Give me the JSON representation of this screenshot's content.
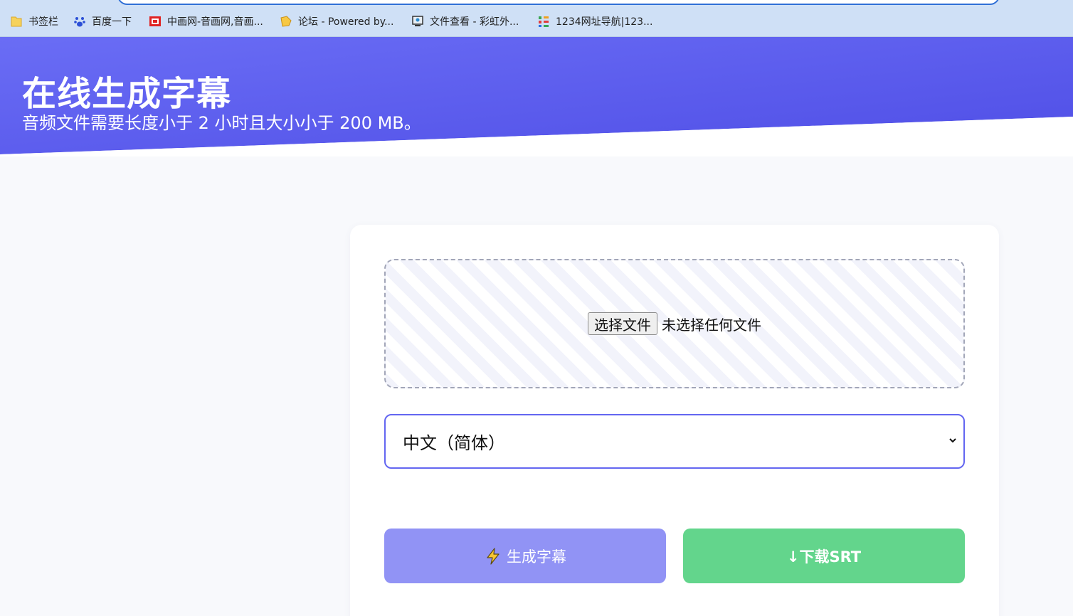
{
  "bookmarks": [
    {
      "label": "书签栏",
      "icon": "folder-icon"
    },
    {
      "label": "百度一下",
      "icon": "baidu-paw-icon"
    },
    {
      "label": "中画网-音画网,音画...",
      "icon": "red-site-icon"
    },
    {
      "label": "论坛 - Powered by...",
      "icon": "forum-icon"
    },
    {
      "label": "文件查看 - 彩虹外...",
      "icon": "file-view-icon"
    },
    {
      "label": "1234网址导航|123...",
      "icon": "nav-icon"
    }
  ],
  "header": {
    "title": "在线生成字幕",
    "subtitle": "音频文件需要长度小于 2 小时且大小小于 200 MB。"
  },
  "upload": {
    "button_label": "选择文件",
    "status": "未选择任何文件"
  },
  "language_select": {
    "selected": "中文（简体）"
  },
  "actions": {
    "generate_label": "生成字幕",
    "download_label": "↓下载SRT"
  },
  "colors": {
    "header_gradient_start": "#6a6df5",
    "header_gradient_end": "#4f4ee6",
    "accent": "#6366f1",
    "generate_button": "#9193f5",
    "download_button": "#63d58c"
  }
}
